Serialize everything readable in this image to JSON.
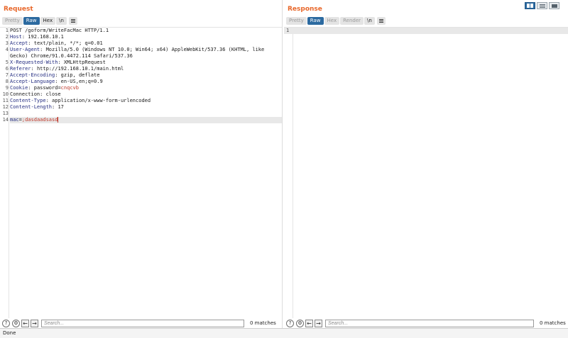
{
  "request": {
    "title": "Request",
    "tabs": [
      {
        "label": "Pretty"
      },
      {
        "label": "Raw"
      },
      {
        "label": "Hex"
      },
      {
        "label": "\\n"
      }
    ],
    "lines": [
      {
        "n": "1",
        "plain": "POST /goform/WriteFacMac HTTP/1.1"
      },
      {
        "n": "2",
        "key": "Host",
        "value": " 192.168.10.1"
      },
      {
        "n": "3",
        "key": "Accept",
        "value": " text/plain, */*; q=0.01"
      },
      {
        "n": "4",
        "key": "User-Agent",
        "value": " Mozilla/5.0 (Windows NT 10.0; Win64; x64) AppleWebKit/537.36 (KHTML, like"
      },
      {
        "n": "",
        "plain": "Gecko) Chrome/91.0.4472.114 Safari/537.36"
      },
      {
        "n": "5",
        "key": "X-Requested-With",
        "value": " XMLHttpRequest"
      },
      {
        "n": "6",
        "key": "Referer",
        "value": " http://192.168.10.1/main.html"
      },
      {
        "n": "7",
        "key": "Accept-Encoding",
        "value": " gzip, deflate"
      },
      {
        "n": "8",
        "key": "Accept-Language",
        "value": " en-US,en;q=0.9"
      },
      {
        "n": "9",
        "key": "Cookie",
        "value": " password=",
        "cookie_val": "cnqcvb"
      },
      {
        "n": "10",
        "plain": "Connection: close"
      },
      {
        "n": "11",
        "key": "Content-Type",
        "value": " application/x-www-form-urlencoded"
      },
      {
        "n": "12",
        "key": "Content-Length",
        "value": " 17"
      },
      {
        "n": "13",
        "plain": ""
      },
      {
        "n": "14",
        "param_key": "mac",
        "param_eq": "=",
        "param_val": ";dasdaadsasd"
      }
    ]
  },
  "response": {
    "title": "Response",
    "tabs": [
      {
        "label": "Pretty"
      },
      {
        "label": "Raw"
      },
      {
        "label": "Hex"
      },
      {
        "label": "Render"
      },
      {
        "label": "\\n"
      }
    ],
    "line_number": "1"
  },
  "search": {
    "placeholder": "Search...",
    "request_matches": "0 matches",
    "response_matches": "0 matches",
    "help_icon": "?",
    "settings_icon": "⚙",
    "back_icon": "←",
    "forward_icon": "→"
  },
  "status": {
    "text": "Done"
  },
  "colors": {
    "accent": "#e8672a",
    "selected_tab": "#2c6aa0"
  }
}
